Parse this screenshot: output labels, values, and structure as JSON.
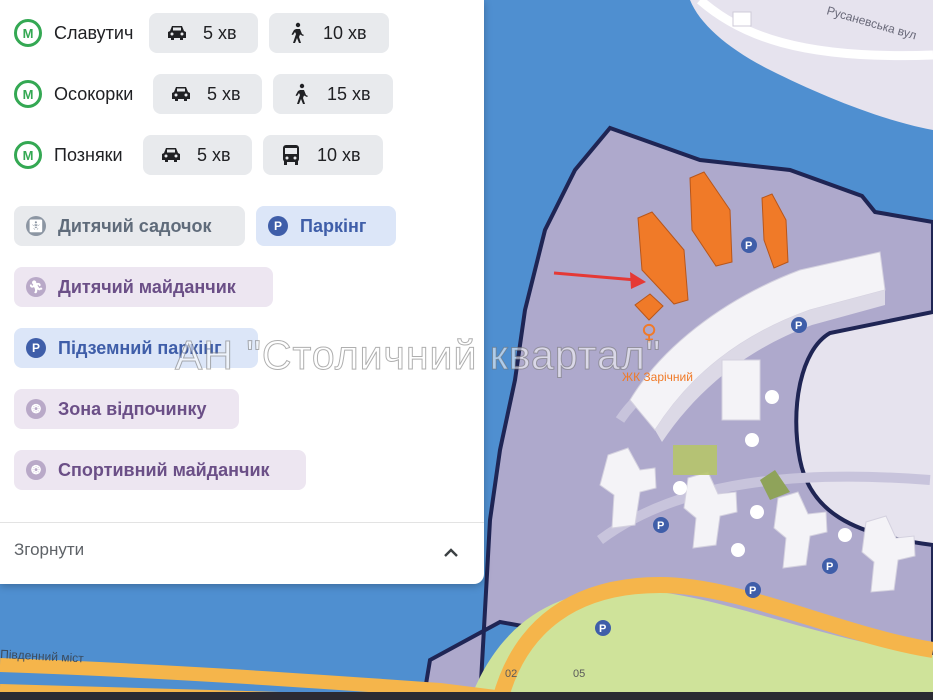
{
  "stations": [
    {
      "name": "Славутич",
      "transport": [
        {
          "icon": "car-icon",
          "time": "5 хв"
        },
        {
          "icon": "walk-icon",
          "time": "10 хв"
        }
      ]
    },
    {
      "name": "Осокорки",
      "transport": [
        {
          "icon": "car-icon",
          "time": "5 хв"
        },
        {
          "icon": "walk-icon",
          "time": "15 хв"
        }
      ]
    },
    {
      "name": "Позняки",
      "transport": [
        {
          "icon": "car-icon",
          "time": "5 хв"
        },
        {
          "icon": "bus-icon",
          "time": "10 хв"
        }
      ]
    }
  ],
  "metro_symbol": "M",
  "amenities": [
    {
      "label": "Дитячий садочок",
      "icon": "stroller-icon",
      "style": "gray"
    },
    {
      "label": "Паркінг",
      "icon": "parking-icon",
      "style": "blue"
    },
    {
      "label": "Дитячий майданчик",
      "icon": "playground-icon",
      "style": "purple"
    },
    {
      "label": "Підземний паркінг",
      "icon": "parking-icon",
      "style": "blue"
    },
    {
      "label": "Зона відпочинку",
      "icon": "bench-icon",
      "style": "purple"
    },
    {
      "label": "Спортивний майданчик",
      "icon": "sport-icon",
      "style": "purple"
    }
  ],
  "parking_letter": "P",
  "collapse_label": "Згорнути",
  "map": {
    "street_label": "Русаневська вул",
    "complex_label": "ЖК Зарічний",
    "bridge_label": "Південний міст",
    "scale_labels": [
      "02",
      "05"
    ]
  },
  "watermark": "АН \"Столичний квартал\"",
  "colors": {
    "water": "#4f8fd0",
    "zone": "#aea9cc",
    "zone_border": "#1f2554",
    "road": "#f5b54b",
    "park": "#cfe39a",
    "metro": "#34a853",
    "highlight_buildings": "#f07a28",
    "arrow": "#e53935"
  }
}
